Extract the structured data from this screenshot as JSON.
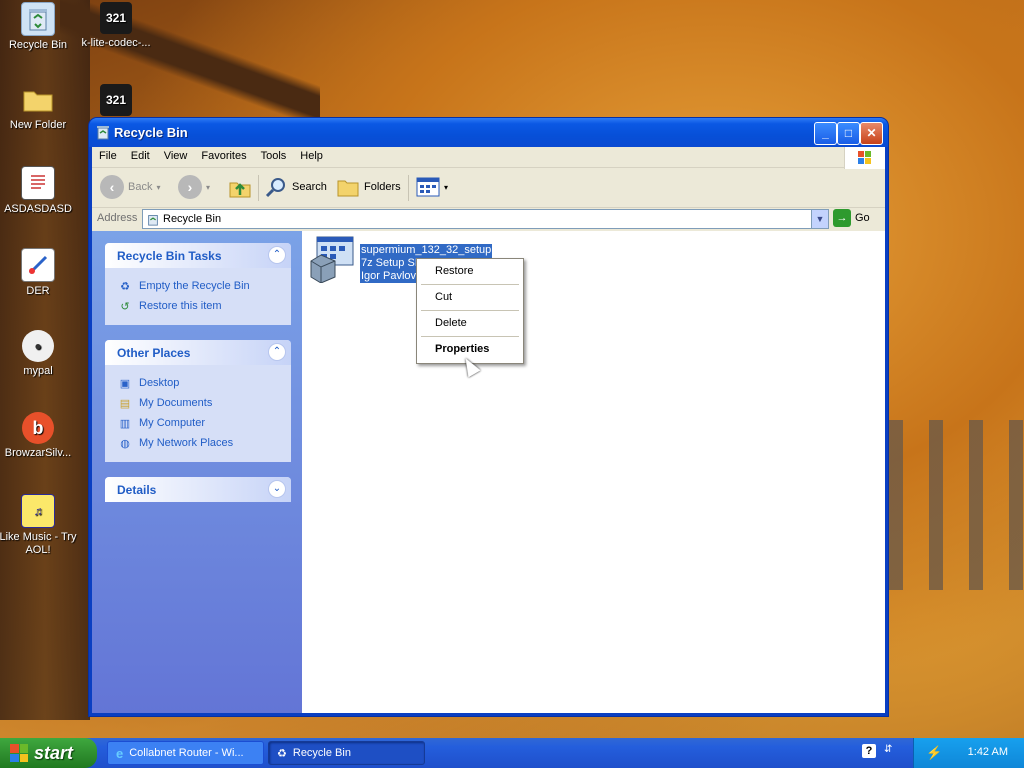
{
  "desktop": {
    "icons": [
      {
        "label": "Recycle Bin",
        "icon": "recycle-bin-icon"
      },
      {
        "label": "k-lite-codec-...",
        "icon": "media-player-icon"
      },
      {
        "label": "New Folder",
        "icon": "folder-icon"
      },
      {
        "label": "",
        "icon": "media-player-icon"
      },
      {
        "label": "ASDASDASD",
        "icon": "document-icon"
      },
      {
        "label": "DER",
        "icon": "paint-icon"
      },
      {
        "label": "mypal",
        "icon": "mypal-icon"
      },
      {
        "label": "BrowzarSilv...",
        "icon": "browzar-icon"
      },
      {
        "label": "Like Music - Try AOL!",
        "icon": "music-icon"
      }
    ]
  },
  "window": {
    "title": "Recycle Bin",
    "menu": [
      "File",
      "Edit",
      "View",
      "Favorites",
      "Tools",
      "Help"
    ],
    "toolbar": {
      "back": "Back",
      "search": "Search",
      "folders": "Folders"
    },
    "address": {
      "label": "Address",
      "value": "Recycle Bin",
      "go": "Go"
    },
    "tasks_panel": {
      "title": "Recycle Bin Tasks",
      "links": [
        "Empty the Recycle Bin",
        "Restore this item"
      ]
    },
    "places_panel": {
      "title": "Other Places",
      "links": [
        "Desktop",
        "My Documents",
        "My Computer",
        "My Network Places"
      ]
    },
    "details_panel": {
      "title": "Details"
    },
    "file": {
      "name": "supermium_132_32_setup",
      "type": "7z Setup SFX",
      "author": "Igor Pavlov"
    }
  },
  "context_menu": {
    "items": [
      "Restore",
      "Cut",
      "Delete",
      "Properties"
    ]
  },
  "taskbar": {
    "start": "start",
    "buttons": [
      "Collabnet Router - Wi...",
      "Recycle Bin"
    ],
    "time": "1:42 AM"
  },
  "colors": {
    "xp_blue": "#0a4ad2",
    "start_green": "#2d8b2d",
    "selection": "#316ac5",
    "task_link": "#215dc6"
  }
}
